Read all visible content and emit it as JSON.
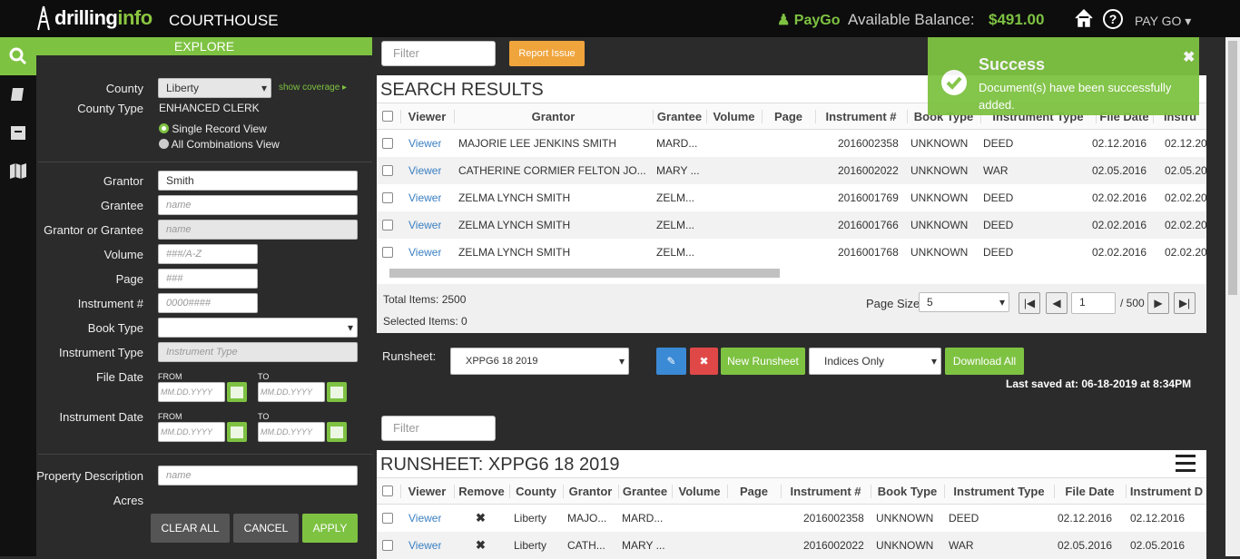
{
  "app": {
    "logo_a": "drilling",
    "logo_b": "info",
    "title": "COURTHOUSE",
    "paygo": "PayGo",
    "balance_label": "Available Balance:",
    "balance": "$491.00",
    "menu": "PAY GO"
  },
  "explore": {
    "header": "EXPLORE",
    "county_label": "County",
    "county_value": "Liberty",
    "show_coverage": "show coverage",
    "county_type_label": "County Type",
    "county_type_value": "ENHANCED CLERK",
    "view_single": "Single Record View",
    "view_all": "All Combinations View",
    "grantor_label": "Grantor",
    "grantor_value": "Smith",
    "grantee_label": "Grantee",
    "grantee_ph": "name",
    "gg_label": "Grantor or Grantee",
    "gg_ph": "name",
    "volume_label": "Volume",
    "volume_ph": "###/A-Z",
    "page_label": "Page",
    "page_ph": "###",
    "instr_label": "Instrument #",
    "instr_ph": "0000####",
    "book_label": "Book Type",
    "itype_label": "Instrument Type",
    "itype_ph": "Instrument Type",
    "file_date_label": "File Date",
    "from": "FROM",
    "to": "TO",
    "date_ph": "MM.DD.YYYY",
    "instr_date_label": "Instrument Date",
    "prop_label": "Property Description",
    "prop_ph": "name",
    "acres_label": "Acres",
    "clear": "CLEAR ALL",
    "cancel": "CANCEL",
    "apply": "APPLY"
  },
  "search": {
    "filter_ph": "Filter",
    "report": "Report Issue",
    "title": "SEARCH RESULTS",
    "headers": [
      "Viewer",
      "Grantor",
      "Grantee",
      "Volume",
      "Page",
      "Instrument #",
      "Book Type",
      "Instrument Type",
      "File Date",
      "Instru"
    ],
    "rows": [
      {
        "viewer": "Viewer",
        "grantor": "MAJORIE LEE JENKINS SMITH",
        "grantee": "MARD...",
        "instr": "2016002358",
        "book": "UNKNOWN",
        "itype": "DEED",
        "file": "02.12.2016",
        "idate": "02.12.20"
      },
      {
        "viewer": "Viewer",
        "grantor": "CATHERINE CORMIER FELTON JO...",
        "grantee": "MARY ...",
        "instr": "2016002022",
        "book": "UNKNOWN",
        "itype": "WAR",
        "file": "02.05.2016",
        "idate": "02.05.20"
      },
      {
        "viewer": "Viewer",
        "grantor": "ZELMA LYNCH SMITH",
        "grantee": "ZELM...",
        "instr": "2016001769",
        "book": "UNKNOWN",
        "itype": "DEED",
        "file": "02.02.2016",
        "idate": "02.02.20"
      },
      {
        "viewer": "Viewer",
        "grantor": "ZELMA LYNCH SMITH",
        "grantee": "ZELM...",
        "instr": "2016001766",
        "book": "UNKNOWN",
        "itype": "DEED",
        "file": "02.02.2016",
        "idate": "02.02.20"
      },
      {
        "viewer": "Viewer",
        "grantor": "ZELMA LYNCH SMITH",
        "grantee": "ZELM...",
        "instr": "2016001768",
        "book": "UNKNOWN",
        "itype": "DEED",
        "file": "02.02.2016",
        "idate": "02.02.20"
      }
    ],
    "total": "Total Items: 2500",
    "selected": "Selected Items: 0",
    "page_size_label": "Page Size:",
    "page_size": "5",
    "page": "1",
    "of": "/ 500"
  },
  "runsheet": {
    "label": "Runsheet:",
    "value": "XPPG6 18 2019",
    "new": "New Runsheet",
    "indices": "Indices Only",
    "download": "Download All",
    "saved": "Last saved at: 06-18-2019 at 8:34PM",
    "filter_ph": "Filter",
    "title": "RUNSHEET: XPPG6 18 2019",
    "headers": [
      "Viewer",
      "Remove",
      "County",
      "Grantor",
      "Grantee",
      "Volume",
      "Page",
      "Instrument #",
      "Book Type",
      "Instrument Type",
      "File Date",
      "Instrument D"
    ],
    "rows": [
      {
        "viewer": "Viewer",
        "county": "Liberty",
        "grantor": "MAJO...",
        "grantee": "MARD...",
        "instr": "2016002358",
        "book": "UNKNOWN",
        "itype": "DEED",
        "file": "02.12.2016",
        "idate": "02.12.2016"
      },
      {
        "viewer": "Viewer",
        "county": "Liberty",
        "grantor": "CATH...",
        "grantee": "MARY ...",
        "instr": "2016002022",
        "book": "UNKNOWN",
        "itype": "WAR",
        "file": "02.05.2016",
        "idate": "02.05.2016"
      }
    ]
  },
  "toast": {
    "title": "Success",
    "message": "Document(s) have been successfully added."
  }
}
